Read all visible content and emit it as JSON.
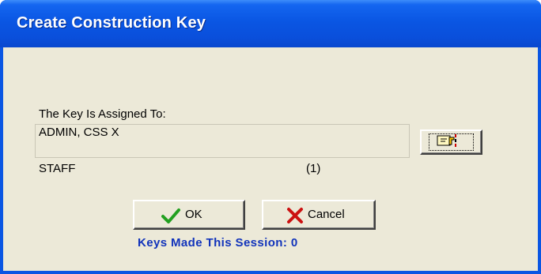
{
  "window": {
    "title": "Create Construction Key"
  },
  "form": {
    "assigned_to_label": "The Key Is Assigned To:",
    "assignee_value": "ADMIN, CSS X",
    "category_label": "STAFF",
    "count_label": "(1)",
    "lookup_icon": "pointing-hand-icon"
  },
  "buttons": {
    "ok_label": "OK",
    "ok_icon": "checkmark-icon",
    "cancel_label": "Cancel",
    "cancel_icon": "x-icon"
  },
  "status": {
    "session_label": "Keys Made This Session: 0"
  },
  "colors": {
    "title_bar": "#0a56e3",
    "dialog_background": "#ece9d8",
    "session_text": "#1133bb",
    "ok_icon": "#22a020",
    "cancel_icon": "#cc1111"
  }
}
